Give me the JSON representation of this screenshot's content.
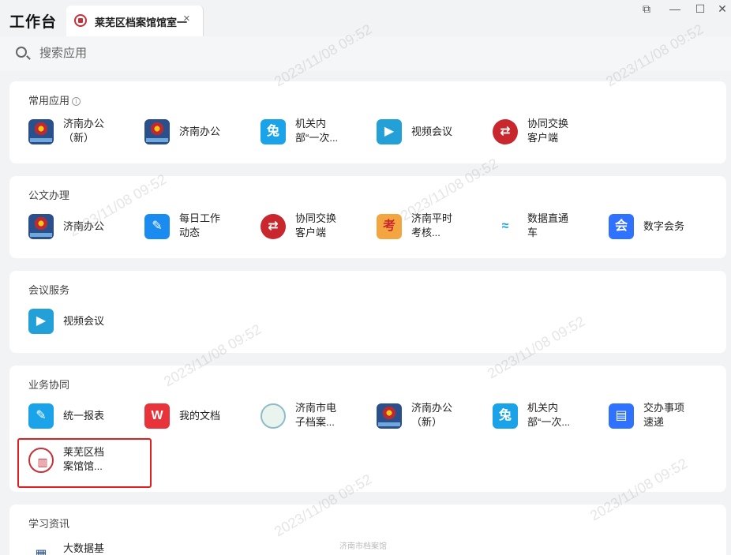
{
  "titlebar": {
    "app_title": "工作台",
    "tab_label": "莱芜区档案馆馆室一",
    "tab_close": "×",
    "win_restore": "⧉",
    "win_minimize": "—",
    "win_maximize": "☐",
    "win_close": "✕"
  },
  "search": {
    "placeholder": "搜索应用"
  },
  "sections": {
    "common": {
      "title": "常用应用",
      "info": "i",
      "items": [
        {
          "label": "济南办公（新）",
          "icon": "emblem-icon"
        },
        {
          "label": "济南办公",
          "icon": "emblem-icon"
        },
        {
          "label": "机关内部“一次...",
          "icon": "runner-icon"
        },
        {
          "label": "视频会议",
          "icon": "video-icon"
        },
        {
          "label": "协同交换客户端",
          "icon": "exchange-icon"
        }
      ]
    },
    "docs": {
      "title": "公文办理",
      "items": [
        {
          "label": "济南办公",
          "icon": "emblem-icon"
        },
        {
          "label": "每日工作动态",
          "icon": "notepad-icon"
        },
        {
          "label": "协同交换客户端",
          "icon": "exchange-icon"
        },
        {
          "label": "济南平时考核...",
          "icon": "kao-icon"
        },
        {
          "label": "数据直通车",
          "icon": "wave-icon"
        },
        {
          "label": "数字会务",
          "icon": "meeting-icon"
        }
      ]
    },
    "meeting": {
      "title": "会议服务",
      "items": [
        {
          "label": "视频会议",
          "icon": "video-icon"
        }
      ]
    },
    "business": {
      "title": "业务协同",
      "items": [
        {
          "label": "统一报表",
          "icon": "edit-icon"
        },
        {
          "label": "我的文档",
          "icon": "wps-icon"
        },
        {
          "label": "济南市电子档案...",
          "icon": "archive-seal-icon"
        },
        {
          "label": "济南办公（新）",
          "icon": "emblem-icon"
        },
        {
          "label": "机关内部“一次...",
          "icon": "runner-icon"
        },
        {
          "label": "交办事项速递",
          "icon": "task-icon"
        },
        {
          "label": "莱芜区档案馆馆...",
          "icon": "laiwu-archive-icon"
        }
      ]
    },
    "study": {
      "title": "学习资讯",
      "items": [
        {
          "label": "大数据基",
          "icon": "book-icon"
        }
      ]
    }
  },
  "watermark_text": "2023/11/08 09:52",
  "footer": "济南市档案馆",
  "colors": {
    "highlight": "#e02020",
    "background": "#f2f3f5",
    "card": "#ffffff"
  }
}
